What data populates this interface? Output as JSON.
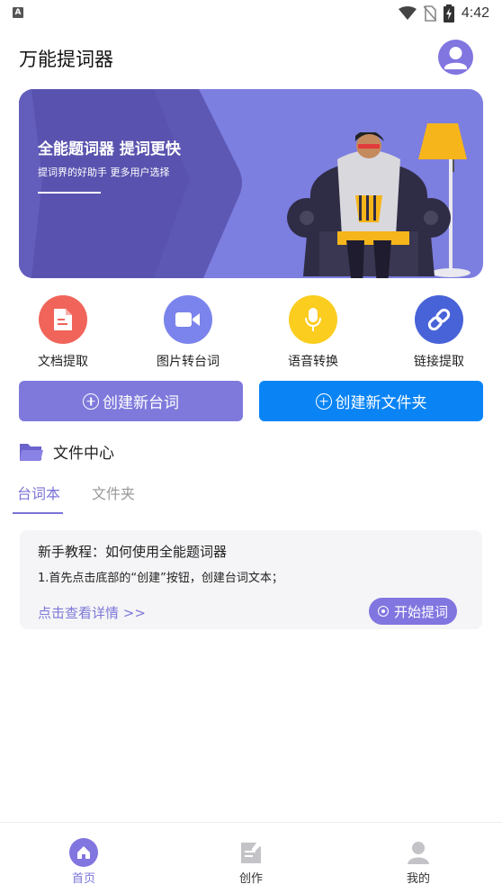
{
  "status_bar": {
    "time": "4:42",
    "notification_letter": "A"
  },
  "header": {
    "title": "万能提词器"
  },
  "banner": {
    "title": "全能题词器 提词更快",
    "subtitle": "提词界的好助手 更多用户选择"
  },
  "shortcuts": [
    {
      "label": "文档提取",
      "icon": "document-icon",
      "color": "#f0645a"
    },
    {
      "label": "图片转台词",
      "icon": "video-camera-icon",
      "color": "#7b83ec"
    },
    {
      "label": "语音转换",
      "icon": "microphone-icon",
      "color": "#fbcd1f"
    },
    {
      "label": "链接提取",
      "icon": "link-icon",
      "color": "#4863d8"
    }
  ],
  "actions": {
    "new_script": "创建新台词",
    "new_folder": "创建新文件夹"
  },
  "file_center": {
    "label": "文件中心"
  },
  "tabs": [
    {
      "label": "台词本",
      "active": true
    },
    {
      "label": "文件夹",
      "active": false
    }
  ],
  "card": {
    "title": "新手教程：如何使用全能题词器",
    "description": "1.首先点击底部的“创建”按钮，创建台词文本；",
    "link": "点击查看详情 >>",
    "button": "开始提词"
  },
  "bottom_nav": [
    {
      "label": "首页",
      "icon": "home-icon",
      "active": true
    },
    {
      "label": "创作",
      "icon": "edit-note-icon",
      "active": false
    },
    {
      "label": "我的",
      "icon": "user-icon",
      "active": false
    }
  ],
  "colors": {
    "accent": "#8175e0",
    "primary_blue": "#0a84f5",
    "banner_bg": "#7c7ee0",
    "banner_dark": "#5b56b4"
  }
}
